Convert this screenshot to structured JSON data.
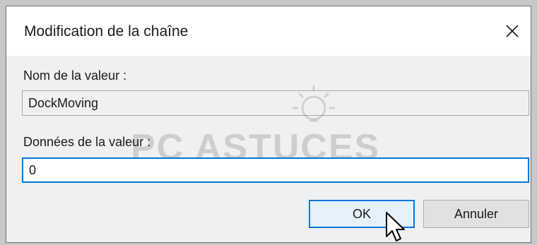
{
  "dialog": {
    "title": "Modification de la chaîne",
    "close_icon": "close-icon"
  },
  "value_name": {
    "label": "Nom de la valeur :",
    "value": "DockMoving"
  },
  "value_data": {
    "label": "Données de la valeur :",
    "value": "0"
  },
  "buttons": {
    "ok_label": "OK",
    "cancel_label": "Annuler"
  },
  "watermark": {
    "text": "PC ASTUCES"
  },
  "colors": {
    "accent": "#0078d7",
    "dialog_bg": "#f0f0f0",
    "titlebar_bg": "#ffffff"
  },
  "icons": [
    "close-icon",
    "mouse-pointer-icon",
    "lightbulb-icon"
  ]
}
